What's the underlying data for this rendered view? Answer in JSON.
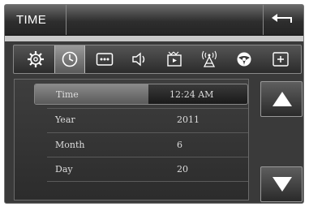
{
  "header": {
    "title": "TIME"
  },
  "toolbar": {
    "icons": [
      "gear-icon",
      "clock-icon",
      "dots-icon",
      "speaker-icon",
      "media-icon",
      "antenna-icon",
      "steering-wheel-icon",
      "plus-icon"
    ],
    "selected": "clock-icon"
  },
  "rows": [
    {
      "label": "Time",
      "value": "12:24 AM"
    },
    {
      "label": "Year",
      "value": "2011"
    },
    {
      "label": "Month",
      "value": "6"
    },
    {
      "label": "Day",
      "value": "20"
    }
  ],
  "colors": {
    "background": "#3a3a3a",
    "highlight": "#8a8a8a",
    "text": "#dddddd"
  }
}
